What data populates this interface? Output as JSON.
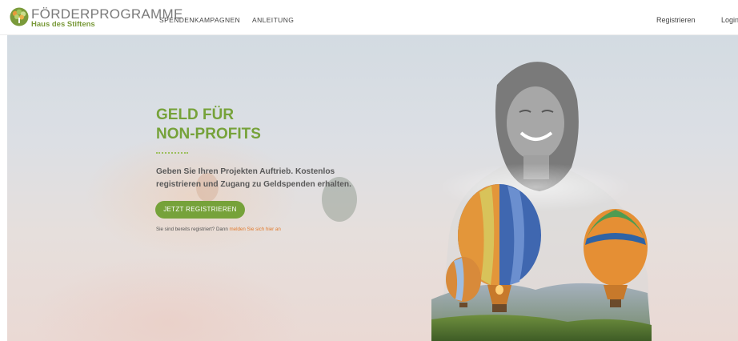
{
  "header": {
    "brand_title": "FÖRDERPROGRAMME",
    "brand_subtitle": "Haus des Stiftens",
    "nav": [
      {
        "label": "SPENDENKAMPAGNEN"
      },
      {
        "label": "ANLEITUNG"
      }
    ],
    "register_label": "Registrieren",
    "login_label": "Login"
  },
  "hero": {
    "headline_line1": "GELD FÜR",
    "headline_line2": "NON-PROFITS",
    "subtext": "Geben Sie Ihren Projekten Auftrieb. Kostenlos registrieren und Zugang zu Geldspenden erhalten.",
    "cta_label": "JETZT REGISTRIEREN",
    "already_prefix": "Sie sind bereits registriert? Dann ",
    "already_link": "melden Sie sich hier an"
  },
  "colors": {
    "brand_green": "#76a23a",
    "link_orange": "#e17b2e"
  },
  "icons": {
    "logo": "tree-logo-icon"
  }
}
